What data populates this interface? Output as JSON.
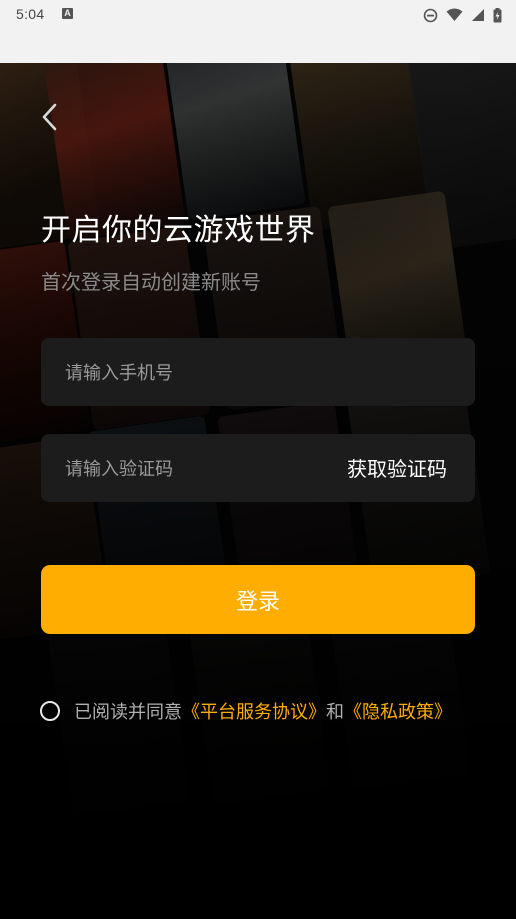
{
  "status_bar": {
    "time": "5:04",
    "notification_icon": "a-icon",
    "icons": [
      "do-not-disturb-icon",
      "wifi-icon",
      "signal-icon",
      "battery-icon"
    ]
  },
  "login": {
    "title": "开启你的云游戏世界",
    "subtitle": "首次登录自动创建新账号",
    "phone_placeholder": "请输入手机号",
    "code_placeholder": "请输入验证码",
    "get_code_label": "获取验证码",
    "login_label": "登录",
    "agreement_prefix": "已阅读并同意",
    "platform_agreement_link": "《平台服务协议》",
    "agreement_and": "和",
    "privacy_policy_link": "《隐私政策》"
  },
  "colors": {
    "accent": "#ffad00",
    "field_bg": "#1c1c1c",
    "background": "#000000"
  }
}
